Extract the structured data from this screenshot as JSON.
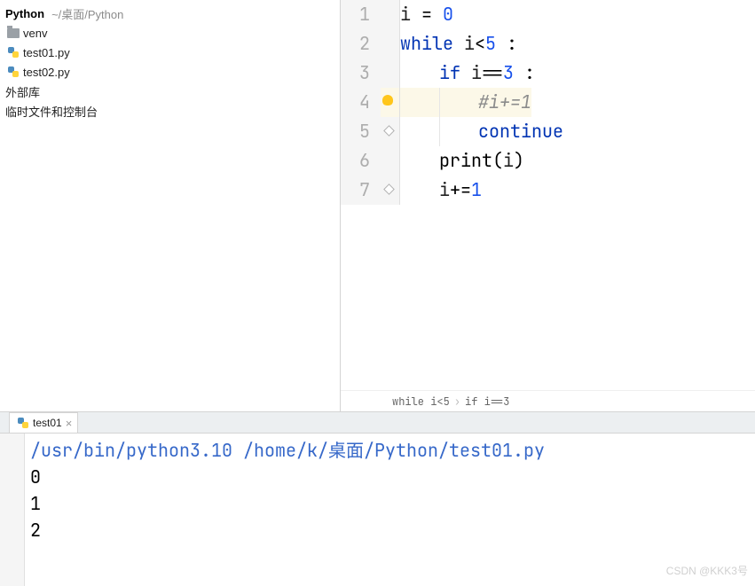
{
  "project": {
    "name": "Python",
    "path": "~/桌面/Python",
    "tree": [
      {
        "type": "folder",
        "label": "venv"
      },
      {
        "type": "py",
        "label": "test01.py"
      },
      {
        "type": "py",
        "label": "test02.py"
      },
      {
        "type": "text",
        "label": "外部库"
      },
      {
        "type": "text",
        "label": "临时文件和控制台"
      }
    ]
  },
  "editor": {
    "lines": [
      {
        "n": "1",
        "indent": 0,
        "tokens": [
          [
            "",
            "i "
          ],
          [
            "op",
            "= "
          ],
          [
            "num",
            "0"
          ]
        ]
      },
      {
        "n": "2",
        "indent": 0,
        "tokens": [
          [
            "kw",
            "while"
          ],
          [
            "",
            " i"
          ],
          [
            "op",
            "<"
          ],
          [
            "num",
            "5 "
          ],
          [
            "op",
            ":"
          ]
        ]
      },
      {
        "n": "3",
        "indent": 1,
        "tokens": [
          [
            "kw",
            "if"
          ],
          [
            "",
            " i"
          ],
          [
            "op",
            "=="
          ],
          [
            "num",
            "3 "
          ],
          [
            "op",
            ":"
          ]
        ]
      },
      {
        "n": "4",
        "indent": 2,
        "hl": true,
        "bulb": true,
        "tokens": [
          [
            "cmt",
            "#i+=1"
          ]
        ]
      },
      {
        "n": "5",
        "indent": 2,
        "fold": true,
        "tokens": [
          [
            "kw",
            "continue"
          ]
        ]
      },
      {
        "n": "6",
        "indent": 1,
        "tokens": [
          [
            "fn",
            "print"
          ],
          [
            "op",
            "("
          ],
          [
            "",
            "i"
          ],
          [
            "op",
            ")"
          ]
        ]
      },
      {
        "n": "7",
        "indent": 1,
        "fold": true,
        "tokens": [
          [
            "",
            "i"
          ],
          [
            "op",
            "+="
          ],
          [
            "num",
            "1"
          ]
        ]
      }
    ]
  },
  "breadcrumbs": [
    "while i<5",
    "if i==3"
  ],
  "console": {
    "tab_label": "test01",
    "command": "/usr/bin/python3.10 /home/k/桌面/Python/test01.py",
    "output": [
      "0",
      "1",
      "2"
    ]
  },
  "watermark": "CSDN @KKK3号"
}
